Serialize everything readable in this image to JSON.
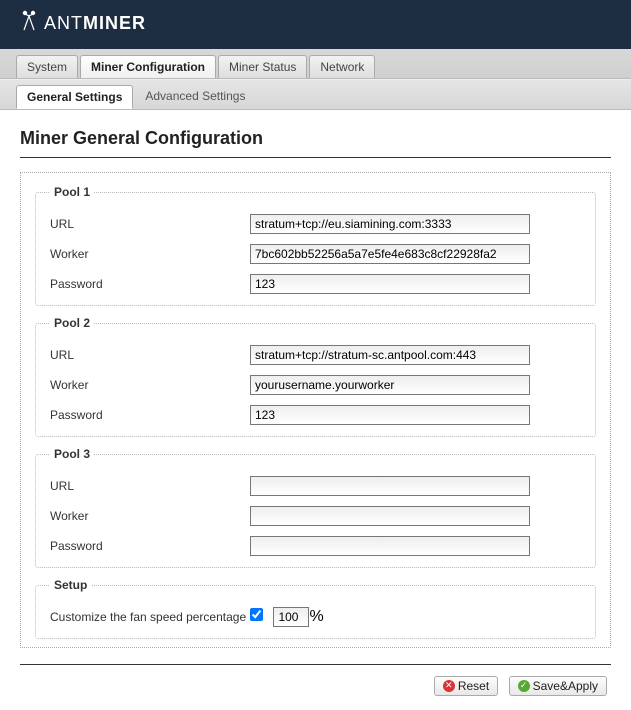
{
  "brand": {
    "name1": "ANT",
    "name2": "MINER"
  },
  "tabs": {
    "main": [
      "System",
      "Miner Configuration",
      "Miner Status",
      "Network"
    ],
    "main_active": 1,
    "sub": [
      "General Settings",
      "Advanced Settings"
    ],
    "sub_active": 0
  },
  "page_title": "Miner General Configuration",
  "labels": {
    "url": "URL",
    "worker": "Worker",
    "password": "Password"
  },
  "pools": [
    {
      "legend": "Pool 1",
      "url": "stratum+tcp://eu.siamining.com:3333",
      "worker": "7bc602bb52256a5a7e5fe4e683c8cf22928fa2",
      "password": "123"
    },
    {
      "legend": "Pool 2",
      "url": "stratum+tcp://stratum-sc.antpool.com:443",
      "worker": "yourusername.yourworker",
      "password": "123"
    },
    {
      "legend": "Pool 3",
      "url": "",
      "worker": "",
      "password": ""
    }
  ],
  "setup": {
    "legend": "Setup",
    "fan_label": "Customize the fan speed percentage",
    "fan_checked": true,
    "fan_value": "100",
    "pct": "%"
  },
  "buttons": {
    "reset": "Reset",
    "save": "Save&Apply"
  }
}
